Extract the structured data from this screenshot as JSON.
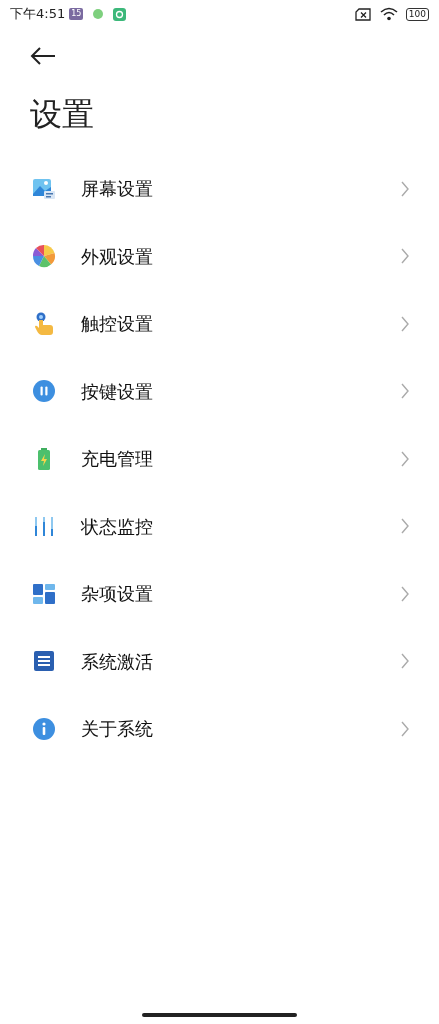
{
  "status_bar": {
    "time": "下午4:51",
    "calendar_badge": "15",
    "battery": "100"
  },
  "title": "设置",
  "items": [
    {
      "kind": "screen",
      "label": "屏幕设置"
    },
    {
      "kind": "palette",
      "label": "外观设置"
    },
    {
      "kind": "touch",
      "label": "触控设置"
    },
    {
      "kind": "keys",
      "label": "按键设置"
    },
    {
      "kind": "battery",
      "label": "充电管理"
    },
    {
      "kind": "sliders",
      "label": "状态监控"
    },
    {
      "kind": "tiles",
      "label": "杂项设置"
    },
    {
      "kind": "list",
      "label": "系统激活"
    },
    {
      "kind": "info",
      "label": "关于系统"
    }
  ]
}
